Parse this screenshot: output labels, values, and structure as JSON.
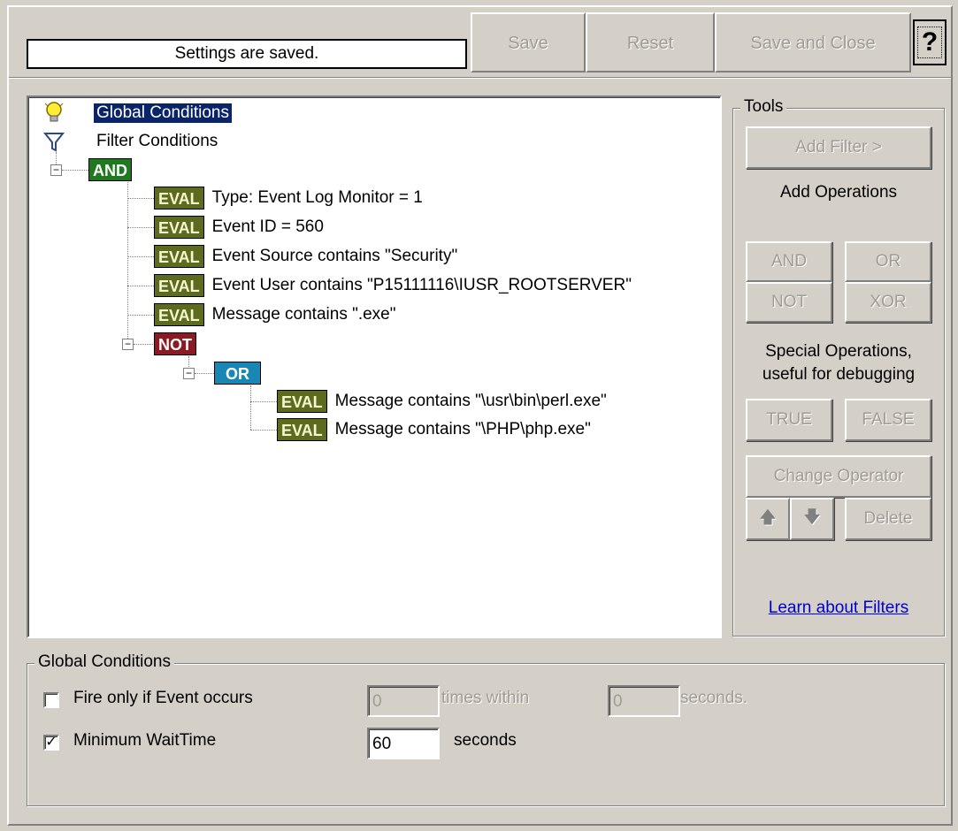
{
  "toolbar": {
    "status_text": "Settings are saved.",
    "save_label": "Save",
    "reset_label": "Reset",
    "save_close_label": "Save and Close",
    "help_label": "?"
  },
  "tree": {
    "global_conditions": "Global Conditions",
    "filter_conditions": "Filter Conditions",
    "and_tag": "AND",
    "not_tag": "NOT",
    "or_tag": "OR",
    "eval_tag": "EVAL",
    "and_children": [
      "Type: Event Log Monitor = 1",
      "Event ID = 560",
      "Event Source contains \"Security\"",
      "Event User contains \"P15111116\\IUSR_ROOTSERVER\"",
      "Message contains \".exe\""
    ],
    "or_children": [
      "Message contains \"\\usr\\bin\\perl.exe\"",
      "Message contains \"\\PHP\\php.exe\""
    ]
  },
  "tools": {
    "title": "Tools",
    "add_filter_label": "Add Filter >",
    "add_operations_label": "Add Operations",
    "and_label": "AND",
    "or_label": "OR",
    "not_label": "NOT",
    "xor_label": "XOR",
    "special_label_line1": "Special Operations,",
    "special_label_line2": "useful for debugging",
    "true_label": "TRUE",
    "false_label": "FALSE",
    "change_operator_label": "Change Operator",
    "up_label": "🡅",
    "down_label": "🡇",
    "delete_label": "Delete",
    "learn_link": "Learn about Filters"
  },
  "global_conditions": {
    "title": "Global Conditions",
    "fire_only_label": "Fire only if Event occurs",
    "fire_only_checked": false,
    "fire_count_value": "0",
    "times_within_label": "times within",
    "fire_seconds_value": "0",
    "seconds_label_1": "seconds.",
    "min_wait_label": "Minimum WaitTime",
    "min_wait_checked": true,
    "min_wait_value": "60",
    "seconds_label_2": "seconds"
  },
  "colors": {
    "window_bg": "#d4d0c8",
    "selection": "#0a246a",
    "eval_tag": "#5c6b1e",
    "and_tag": "#1f7a1f",
    "not_tag": "#8b1a22",
    "or_tag": "#1a86b3",
    "link": "#0000cc"
  }
}
